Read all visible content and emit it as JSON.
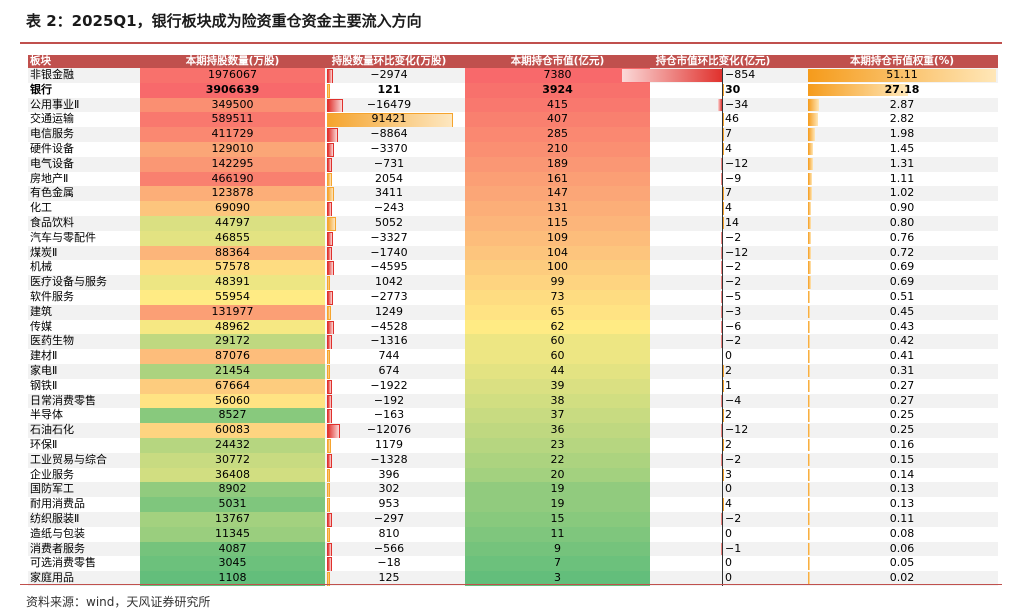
{
  "title": "表 2：2025Q1，银行板块成为险资重仓资金主要流入方向",
  "source": "资料来源：wind，天风证券研究所",
  "colors": {
    "accent": "#c0504d",
    "heat_high": "#f8696b",
    "heat_mid": "#ffeb84",
    "heat_low": "#63be7b",
    "bar_neg": "#e0312d",
    "bar_pos": "#f5a42e"
  },
  "headers": [
    "板块",
    "本期持股数量(万股)",
    "持股数量环比变化(万股)",
    "本期持仓市值(亿元)",
    "持仓市值环比变化(亿元)",
    "本期持仓市值权重(%)"
  ],
  "rows": [
    {
      "name": "非银金融",
      "shares": "1976067",
      "shares_chg": "−2974",
      "mv": "7380",
      "mv_chg": "−854",
      "weight": "51.11"
    },
    {
      "name": "银行",
      "shares": "3906639",
      "shares_chg": "121",
      "mv": "3924",
      "mv_chg": "30",
      "weight": "27.18"
    },
    {
      "name": "公用事业Ⅱ",
      "shares": "349500",
      "shares_chg": "−16479",
      "mv": "415",
      "mv_chg": "−34",
      "weight": "2.87"
    },
    {
      "name": "交通运输",
      "shares": "589511",
      "shares_chg": "91421",
      "mv": "407",
      "mv_chg": "46",
      "weight": "2.82"
    },
    {
      "name": "电信服务",
      "shares": "411729",
      "shares_chg": "−8864",
      "mv": "285",
      "mv_chg": "7",
      "weight": "1.98"
    },
    {
      "name": "硬件设备",
      "shares": "129010",
      "shares_chg": "−3370",
      "mv": "210",
      "mv_chg": "4",
      "weight": "1.45"
    },
    {
      "name": "电气设备",
      "shares": "142295",
      "shares_chg": "−731",
      "mv": "189",
      "mv_chg": "−12",
      "weight": "1.31"
    },
    {
      "name": "房地产Ⅱ",
      "shares": "466190",
      "shares_chg": "2054",
      "mv": "161",
      "mv_chg": "−9",
      "weight": "1.11"
    },
    {
      "name": "有色金属",
      "shares": "123878",
      "shares_chg": "3411",
      "mv": "147",
      "mv_chg": "7",
      "weight": "1.02"
    },
    {
      "name": "化工",
      "shares": "69090",
      "shares_chg": "−243",
      "mv": "131",
      "mv_chg": "4",
      "weight": "0.90"
    },
    {
      "name": "食品饮料",
      "shares": "44797",
      "shares_chg": "5052",
      "mv": "115",
      "mv_chg": "14",
      "weight": "0.80"
    },
    {
      "name": "汽车与零配件",
      "shares": "46855",
      "shares_chg": "−3327",
      "mv": "109",
      "mv_chg": "−2",
      "weight": "0.76"
    },
    {
      "name": "煤炭Ⅱ",
      "shares": "88364",
      "shares_chg": "−1740",
      "mv": "104",
      "mv_chg": "−12",
      "weight": "0.72"
    },
    {
      "name": "机械",
      "shares": "57578",
      "shares_chg": "−4595",
      "mv": "100",
      "mv_chg": "−2",
      "weight": "0.69"
    },
    {
      "name": "医疗设备与服务",
      "shares": "48391",
      "shares_chg": "1042",
      "mv": "99",
      "mv_chg": "−2",
      "weight": "0.69"
    },
    {
      "name": "软件服务",
      "shares": "55954",
      "shares_chg": "−2773",
      "mv": "73",
      "mv_chg": "−5",
      "weight": "0.51"
    },
    {
      "name": "建筑",
      "shares": "131977",
      "shares_chg": "1249",
      "mv": "65",
      "mv_chg": "−3",
      "weight": "0.45"
    },
    {
      "name": "传媒",
      "shares": "48962",
      "shares_chg": "−4528",
      "mv": "62",
      "mv_chg": "−6",
      "weight": "0.43"
    },
    {
      "name": "医药生物",
      "shares": "29172",
      "shares_chg": "−1316",
      "mv": "60",
      "mv_chg": "−2",
      "weight": "0.42"
    },
    {
      "name": "建材Ⅱ",
      "shares": "87076",
      "shares_chg": "744",
      "mv": "60",
      "mv_chg": "0",
      "weight": "0.41"
    },
    {
      "name": "家电Ⅱ",
      "shares": "21454",
      "shares_chg": "674",
      "mv": "44",
      "mv_chg": "2",
      "weight": "0.31"
    },
    {
      "name": "钢铁Ⅱ",
      "shares": "67664",
      "shares_chg": "−1922",
      "mv": "39",
      "mv_chg": "1",
      "weight": "0.27"
    },
    {
      "name": "日常消费零售",
      "shares": "56060",
      "shares_chg": "−192",
      "mv": "38",
      "mv_chg": "−4",
      "weight": "0.27"
    },
    {
      "name": "半导体",
      "shares": "8527",
      "shares_chg": "−163",
      "mv": "37",
      "mv_chg": "2",
      "weight": "0.25"
    },
    {
      "name": "石油石化",
      "shares": "60083",
      "shares_chg": "−12076",
      "mv": "36",
      "mv_chg": "−12",
      "weight": "0.25"
    },
    {
      "name": "环保Ⅱ",
      "shares": "24432",
      "shares_chg": "1179",
      "mv": "23",
      "mv_chg": "2",
      "weight": "0.16"
    },
    {
      "name": "工业贸易与综合",
      "shares": "30772",
      "shares_chg": "−1328",
      "mv": "22",
      "mv_chg": "−2",
      "weight": "0.15"
    },
    {
      "name": "企业服务",
      "shares": "36408",
      "shares_chg": "396",
      "mv": "20",
      "mv_chg": "3",
      "weight": "0.14"
    },
    {
      "name": "国防军工",
      "shares": "8902",
      "shares_chg": "302",
      "mv": "19",
      "mv_chg": "0",
      "weight": "0.13"
    },
    {
      "name": "耐用消费品",
      "shares": "5031",
      "shares_chg": "953",
      "mv": "19",
      "mv_chg": "4",
      "weight": "0.13"
    },
    {
      "name": "纺织服装Ⅱ",
      "shares": "13767",
      "shares_chg": "−297",
      "mv": "15",
      "mv_chg": "−2",
      "weight": "0.11"
    },
    {
      "name": "造纸与包装",
      "shares": "11345",
      "shares_chg": "810",
      "mv": "11",
      "mv_chg": "0",
      "weight": "0.08"
    },
    {
      "name": "消费者服务",
      "shares": "4087",
      "shares_chg": "−566",
      "mv": "9",
      "mv_chg": "−1",
      "weight": "0.06"
    },
    {
      "name": "可选消费零售",
      "shares": "3045",
      "shares_chg": "−18",
      "mv": "7",
      "mv_chg": "0",
      "weight": "0.05"
    },
    {
      "name": "家庭用品",
      "shares": "1108",
      "shares_chg": "125",
      "mv": "3",
      "mv_chg": "0",
      "weight": "0.02"
    }
  ]
}
